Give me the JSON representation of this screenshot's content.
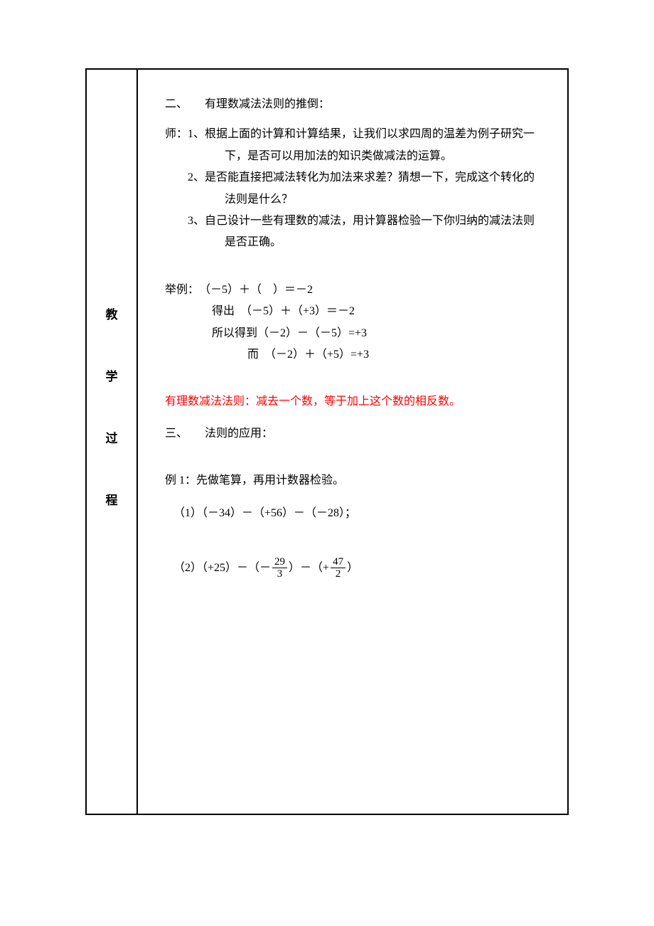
{
  "left_labels": {
    "l1": "教",
    "l2": "学",
    "l3": "过",
    "l4": "程"
  },
  "section2": {
    "heading": "二、　　有理数减法法则的推倒：",
    "teacher_label": "师：",
    "items": [
      {
        "num": "1、",
        "text_a": "根据上面的计算和计算结果，让我们以求四周的温差为例子研究一",
        "text_b": "下，是否可以用加法的知识类做减法的运算。"
      },
      {
        "num": "2、",
        "text_a": "是否能直接把减法转化为加法来求差？猜想一下，完成这个转化的",
        "text_b": "法则是什么？"
      },
      {
        "num": "3、",
        "text_a": "自己设计一些有理数的减法，用计算器检验一下你归纳的减法法则",
        "text_b": "是否正确。"
      }
    ]
  },
  "example_lines": {
    "l1": "举例：　（－5）＋（　）＝－2",
    "l2": "得出　（－5）＋（+3）＝－2",
    "l3": "所以得到（－2）－（－5）=+3",
    "l4": "而　（－2）＋（+5）=+3"
  },
  "rule_red": "有理数减法法则：减去一个数，等于加上这个数的相反数。",
  "section3": {
    "heading": "三、　　法则的应用：",
    "ex1_title": "例 1：先做笔算，再用计数器检验。",
    "q1": "（1）（－34）－（+56）－（－28）；",
    "q2_prefix": "（2）（+25）－（－",
    "q2_mid": "）－（+",
    "q2_suffix": "）",
    "frac1": {
      "num": "29",
      "den": "3"
    },
    "frac2": {
      "num": "47",
      "den": "2"
    }
  }
}
